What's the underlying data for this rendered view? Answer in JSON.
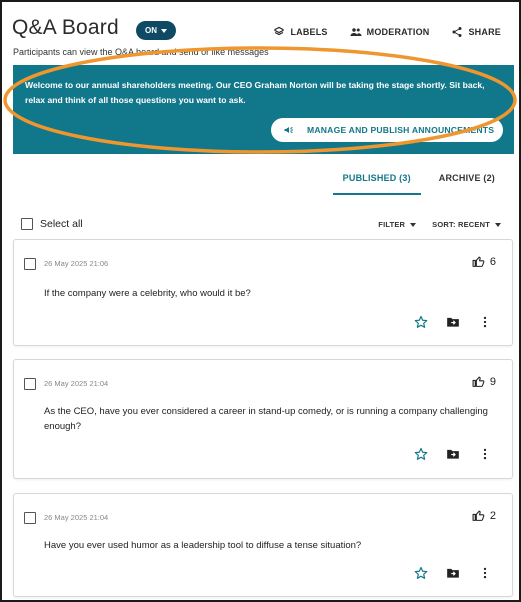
{
  "header": {
    "title": "Q&A Board",
    "toggle_label": "ON",
    "subtitle": "Participants can view the Q&A board and send or like messages",
    "links": [
      {
        "label": "LABELS",
        "icon": "label-icon"
      },
      {
        "label": "MODERATION",
        "icon": "people-icon"
      },
      {
        "label": "SHARE",
        "icon": "share-icon"
      }
    ]
  },
  "announcement": {
    "text": "Welcome to our annual shareholders meeting. Our CEO Graham Norton will be taking the stage shortly. Sit back, relax and think of all those questions you want to ask.",
    "button_label": "MANAGE AND PUBLISH ANNOUNCEMENTS",
    "button_icon": "megaphone-icon",
    "background": "#11778a"
  },
  "tabs": [
    {
      "label": "PUBLISHED (3)",
      "active": true
    },
    {
      "label": "ARCHIVE (2)",
      "active": false
    }
  ],
  "toolbar": {
    "select_all": "Select all",
    "filter": "FILTER",
    "sort": "SORT: RECENT"
  },
  "questions": [
    {
      "date": "26 May 2025 21:06",
      "likes": "6",
      "text": "If the company were a celebrity, who would it be?"
    },
    {
      "date": "26 May 2025 21:04",
      "likes": "9",
      "text": "As the CEO, have you ever considered a career in stand-up comedy, or is running a company challenging enough?"
    },
    {
      "date": "26 May 2025 21:04",
      "likes": "2",
      "text": "Have you ever used humor as a leadership tool to diffuse a tense situation?"
    }
  ],
  "colors": {
    "accent": "#11778a",
    "toggle": "#0e4a64",
    "highlight": "#f0962e"
  }
}
